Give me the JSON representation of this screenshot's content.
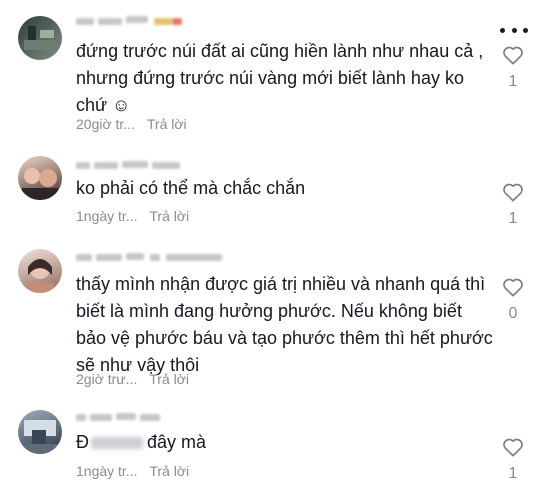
{
  "comments": [
    {
      "text": "đứng trước núi đất ai cũng hiền lành như nhau cả ,\nnhưng đứng trước núi vàng mới biết lành hay ko\nchứ ☺",
      "time": "20giờ tr...",
      "reply": "Trả lời",
      "likes": "1",
      "avatar_colors": [
        "#3c4a4a",
        "#6b7f72"
      ]
    },
    {
      "text": "ko phải có thể mà chắc chắn",
      "time": "1ngày tr...",
      "reply": "Trả lời",
      "likes": "1",
      "avatar_colors": [
        "#c9a48f",
        "#4d3b36"
      ]
    },
    {
      "text": "thấy mình nhận được giá trị nhiều và nhanh quá thì\nbiết là mình đang hưởng phước. Nếu không biết\nbảo vệ phước báu và tạo phước thêm thì hết phước\nsẽ như vậy thôi",
      "time": "2giờ trư...",
      "reply": "Trả lời",
      "likes": "0",
      "avatar_colors": [
        "#d8b7a6",
        "#7a5a4d"
      ]
    },
    {
      "text_prefix": "Đ",
      "text_suffix": "đây mà",
      "time": "1ngày tr...",
      "reply": "Trả lời",
      "likes": "1",
      "avatar_colors": [
        "#5a6d82",
        "#2c3440"
      ]
    }
  ]
}
